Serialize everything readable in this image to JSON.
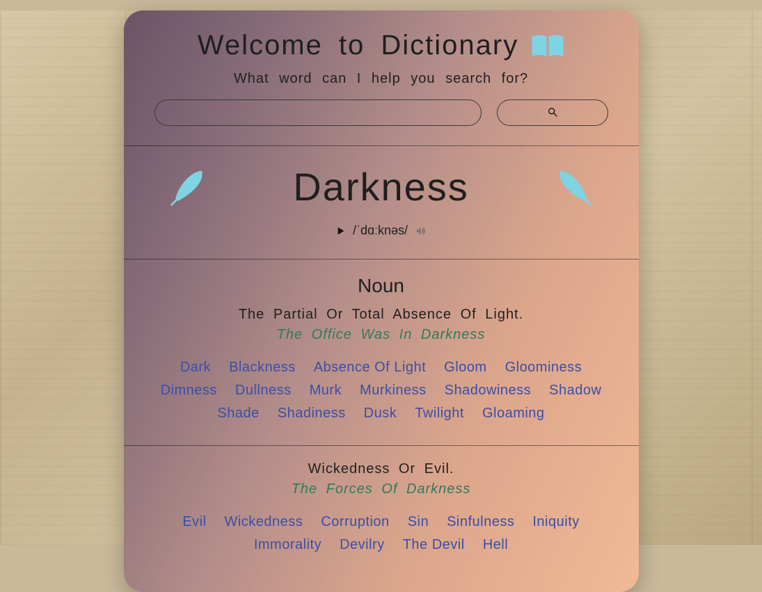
{
  "header": {
    "title": "Welcome to Dictionary",
    "subtitle": "What word can I help you search for?"
  },
  "search": {
    "value": "",
    "placeholder": ""
  },
  "entry": {
    "word": "Darkness",
    "pronunciation": "/ˈdɑːknəs/"
  },
  "senses": [
    {
      "pos": "Noun",
      "definition": "The Partial Or Total Absence Of Light.",
      "example": "The Office Was In Darkness",
      "synonyms": [
        "Dark",
        "Blackness",
        "Absence Of Light",
        "Gloom",
        "Gloominess",
        "Dimness",
        "Dullness",
        "Murk",
        "Murkiness",
        "Shadowiness",
        "Shadow",
        "Shade",
        "Shadiness",
        "Dusk",
        "Twilight",
        "Gloaming"
      ]
    },
    {
      "pos": "",
      "definition": "Wickedness Or Evil.",
      "example": "The Forces Of Darkness",
      "synonyms": [
        "Evil",
        "Wickedness",
        "Corruption",
        "Sin",
        "Sinfulness",
        "Iniquity",
        "Immorality",
        "Devilry",
        "The Devil",
        "Hell"
      ]
    }
  ],
  "icons": {
    "book": "book-icon",
    "feather": "feather-icon",
    "search": "search-icon",
    "play": "play-icon",
    "volume": "volume-icon"
  },
  "colors": {
    "accent_link": "#3a4ea8",
    "example_text": "#2f7a5a",
    "icon_cyan": "#7fd4e3"
  }
}
